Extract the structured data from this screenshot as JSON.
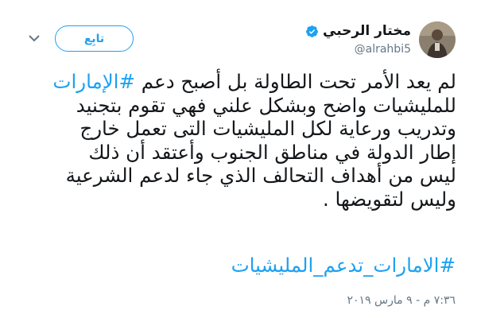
{
  "user": {
    "display_name": "مختار الرحبي",
    "handle": "@alrahbi5",
    "verified": true
  },
  "actions": {
    "follow_label": "تابِع"
  },
  "tweet": {
    "line1_before": "لم يعد الأمر تحت الطاولة بل أصبح دعم ",
    "line1_hashtag": "#الإمارات",
    "line2": "للمليشيات واضح وبشكل علني فهي تقوم بتجنيد",
    "line3": "وتدريب ورعاية لكل المليشيات التى تعمل خارج",
    "line4": "إطار الدولة في مناطق الجنوب وأعتقد أن ذلك",
    "line5": "ليس من أهداف التحالف الذي جاء لدعم الشرعية",
    "line6": "وليس لتقويضها .",
    "hashtag": "#الامارات_تدعم_المليشيات"
  },
  "timestamp": "٧:٣٦ م - ٩ مارس ٢٠١٩",
  "colors": {
    "accent": "#1da1f2",
    "text": "#14171a",
    "muted": "#657786"
  },
  "icons": {
    "verified": "verified-badge-icon",
    "more": "chevron-down-icon"
  }
}
